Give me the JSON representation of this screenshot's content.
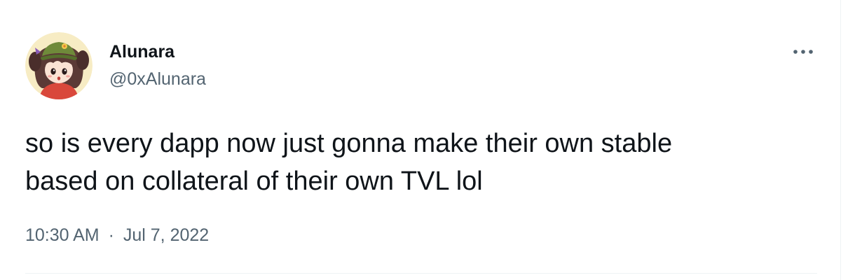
{
  "author": {
    "display_name": "Alunara",
    "handle": "@0xAlunara",
    "avatar_icon": "anime-girl-avatar-icon"
  },
  "tweet": {
    "text_lines": [
      "so is every dapp now just gonna make their own stable",
      "based on collateral of their own TVL lol"
    ],
    "time": "10:30 AM",
    "separator": "·",
    "date": "Jul 7, 2022"
  },
  "actions": {
    "more_icon": "more-horizontal-icon"
  },
  "colors": {
    "text_primary": "#0f1419",
    "text_secondary": "#536471",
    "divider": "#eff3f4",
    "avatar_bg": "#f7ecc4"
  }
}
